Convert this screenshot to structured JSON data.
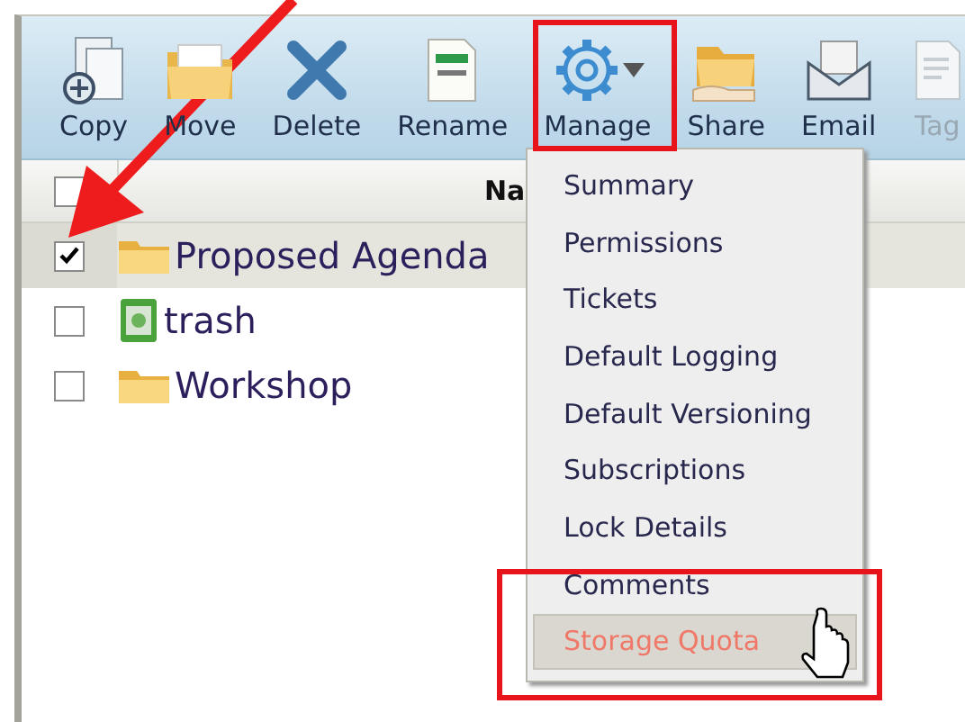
{
  "toolbar": {
    "buttons": [
      {
        "label": "Copy",
        "kind": "copy",
        "disabled": false,
        "has_menu": false
      },
      {
        "label": "Move",
        "kind": "move",
        "disabled": false,
        "has_menu": false
      },
      {
        "label": "Delete",
        "kind": "delete",
        "disabled": false,
        "has_menu": false
      },
      {
        "label": "Rename",
        "kind": "rename",
        "disabled": false,
        "has_menu": false
      },
      {
        "label": "Manage",
        "kind": "manage",
        "disabled": false,
        "has_menu": true
      },
      {
        "label": "Share",
        "kind": "share",
        "disabled": false,
        "has_menu": false
      },
      {
        "label": "Email",
        "kind": "email",
        "disabled": false,
        "has_menu": false
      },
      {
        "label": "Tag",
        "kind": "tag",
        "disabled": true,
        "has_menu": false
      }
    ]
  },
  "table": {
    "header": {
      "checked": false,
      "column_2": "Na"
    },
    "rows": [
      {
        "name": "Proposed Agenda",
        "kind": "folder",
        "checked": true,
        "selected": true
      },
      {
        "name": "trash",
        "kind": "trash",
        "checked": false,
        "selected": false
      },
      {
        "name": "Workshop",
        "kind": "folder",
        "checked": false,
        "selected": false
      }
    ]
  },
  "manage_menu": {
    "items": [
      {
        "label": "Summary",
        "selected": false
      },
      {
        "label": "Permissions",
        "selected": false
      },
      {
        "label": "Tickets",
        "selected": false
      },
      {
        "label": "Default Logging",
        "selected": false
      },
      {
        "label": "Default Versioning",
        "selected": false
      },
      {
        "label": "Subscriptions",
        "selected": false
      },
      {
        "label": "Lock Details",
        "selected": false
      },
      {
        "label": "Comments",
        "selected": false
      },
      {
        "label": "Storage Quota",
        "selected": true
      }
    ]
  }
}
